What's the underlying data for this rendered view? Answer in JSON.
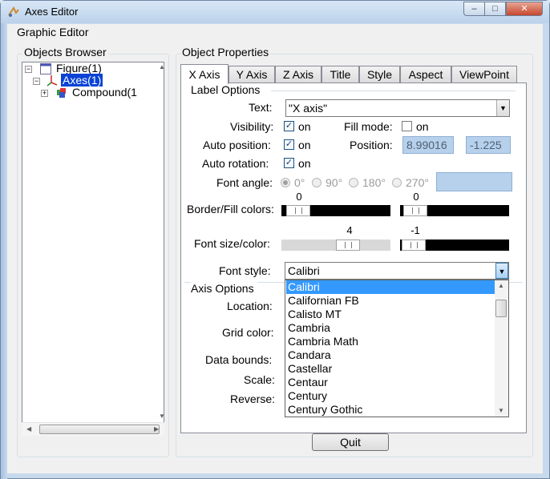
{
  "window": {
    "title": "Axes Editor",
    "controls": {
      "minimize": "–",
      "maximize": "□",
      "close": "✕"
    }
  },
  "menu": {
    "label": "Graphic Editor"
  },
  "browser": {
    "title": "Objects Browser",
    "items": [
      {
        "label": "Figure(1)",
        "expander": "−"
      },
      {
        "label": "Axes(1)",
        "expander": "−"
      },
      {
        "label": "Compound(1",
        "expander": "+"
      }
    ]
  },
  "props": {
    "title": "Object Properties",
    "tabs": [
      "X Axis",
      "Y Axis",
      "Z Axis",
      "Title",
      "Style",
      "Aspect",
      "ViewPoint"
    ],
    "label_options": {
      "title": "Label Options",
      "text_label": "Text:",
      "text_value": "\"X axis\"",
      "visibility_label": "Visibility:",
      "visibility_on": "on",
      "fill_mode_label": "Fill mode:",
      "fill_mode_on": "on",
      "auto_position_label": "Auto position:",
      "auto_position_on": "on",
      "position_label": "Position:",
      "position_x": "8.99016",
      "position_y": "-1.225",
      "auto_rotation_label": "Auto rotation:",
      "auto_rotation_on": "on",
      "font_angle_label": "Font angle:",
      "angles": [
        "0°",
        "90°",
        "180°",
        "270°"
      ],
      "border_fill_label": "Border/Fill colors:",
      "border_value": "0",
      "fill_value": "0",
      "font_size_color_label": "Font size/color:",
      "font_size_value": "4",
      "font_color_value": "-1",
      "font_style_label": "Font style:",
      "font_style_value": "Calibri"
    },
    "axis_options": {
      "title": "Axis Options",
      "location_label": "Location:",
      "grid_color_label": "Grid color:",
      "data_bounds_label": "Data bounds:",
      "scale_label": "Scale:",
      "reverse_label": "Reverse:"
    },
    "dropdown_fonts": [
      "Calibri",
      "Californian FB",
      "Calisto MT",
      "Cambria",
      "Cambria Math",
      "Candara",
      "Castellar",
      "Centaur",
      "Century",
      "Century Gothic"
    ]
  },
  "quit_label": "Quit",
  "colors": {
    "selection": "#0a43d6",
    "list_highlight": "#3399ff"
  }
}
